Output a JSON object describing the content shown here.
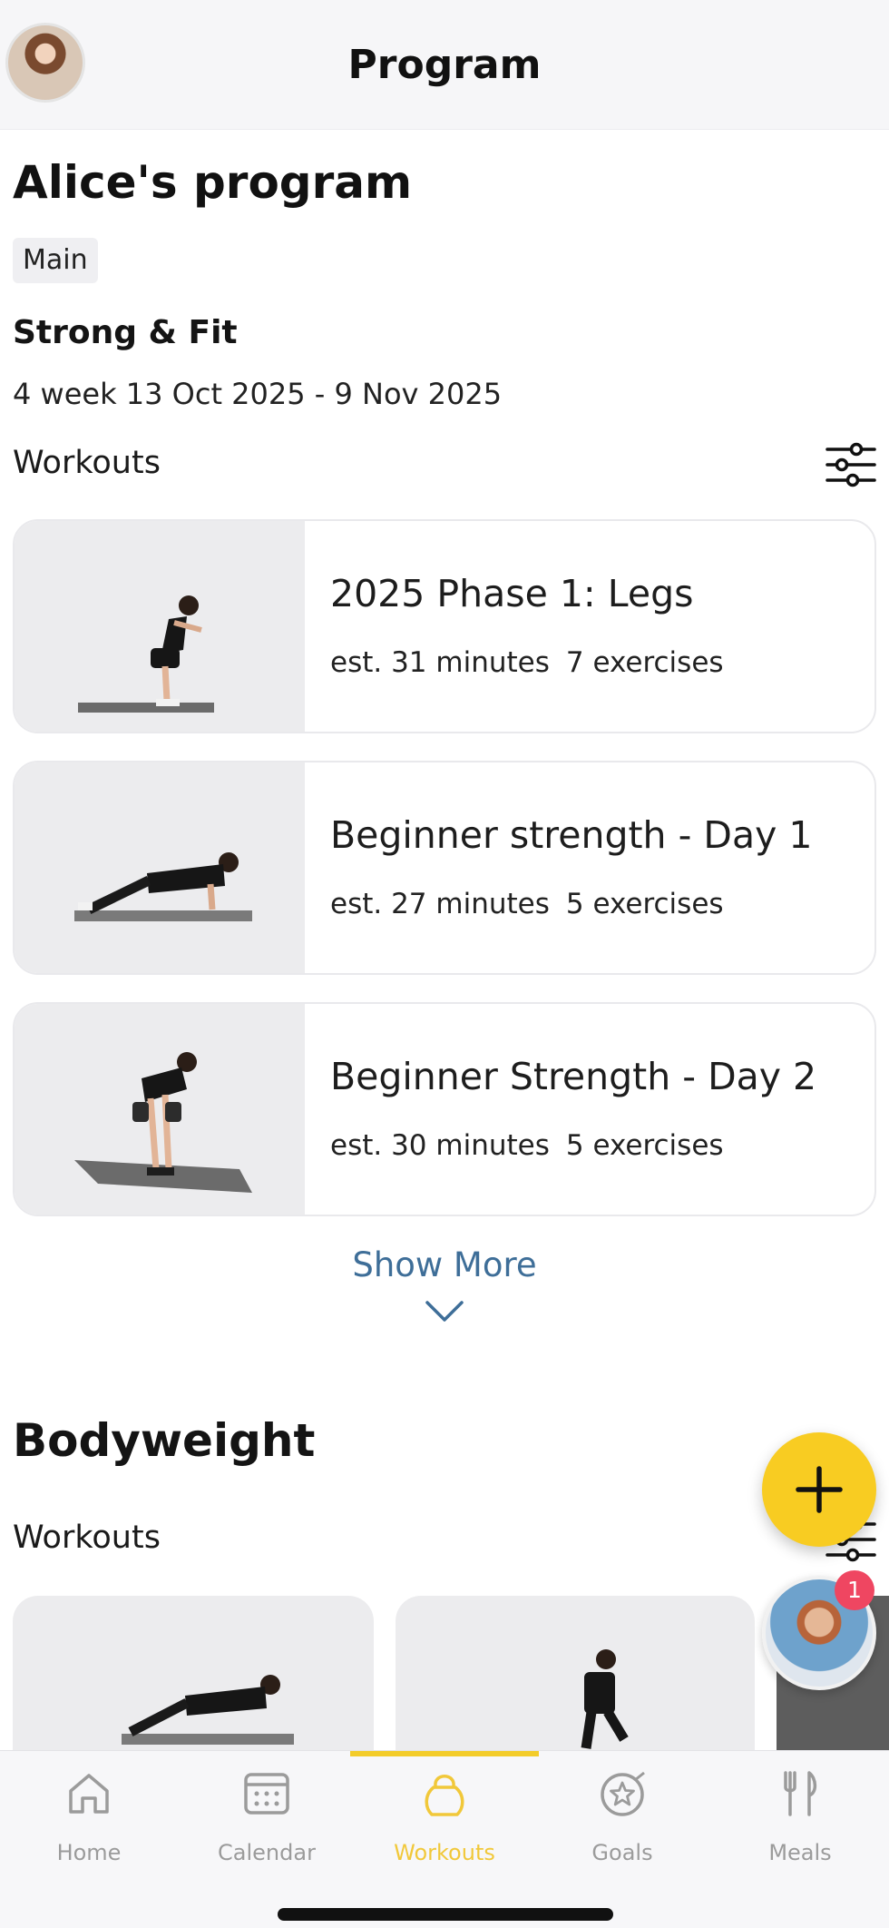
{
  "header": {
    "title": "Program"
  },
  "program": {
    "title": "Alice's program",
    "tag": "Main",
    "plan_name": "Strong & Fit",
    "plan_dates": "4 week 13 Oct 2025 - 9 Nov 2025",
    "workouts_label": "Workouts",
    "workouts": [
      {
        "title": "2025 Phase 1: Legs",
        "duration": "est. 31 minutes",
        "exercises": "7 exercises"
      },
      {
        "title": "Beginner strength - Day 1",
        "duration": "est. 27 minutes",
        "exercises": "5 exercises"
      },
      {
        "title": "Beginner Strength - Day 2",
        "duration": "est. 30 minutes",
        "exercises": "5 exercises"
      }
    ],
    "show_more": "Show More"
  },
  "bodyweight": {
    "title": "Bodyweight",
    "workouts_label": "Workouts"
  },
  "chat": {
    "badge_count": "1"
  },
  "tabbar": {
    "items": [
      {
        "label": "Home",
        "icon": "home-icon"
      },
      {
        "label": "Calendar",
        "icon": "calendar-icon"
      },
      {
        "label": "Workouts",
        "icon": "kettlebell-icon"
      },
      {
        "label": "Goals",
        "icon": "target-star-icon"
      },
      {
        "label": "Meals",
        "icon": "fork-knife-icon"
      }
    ],
    "active": "Workouts"
  },
  "colors": {
    "accent": "#f8cc22",
    "link": "#3e6e98",
    "badge": "#ef4661",
    "inactive_tab": "#9b9b9b"
  }
}
